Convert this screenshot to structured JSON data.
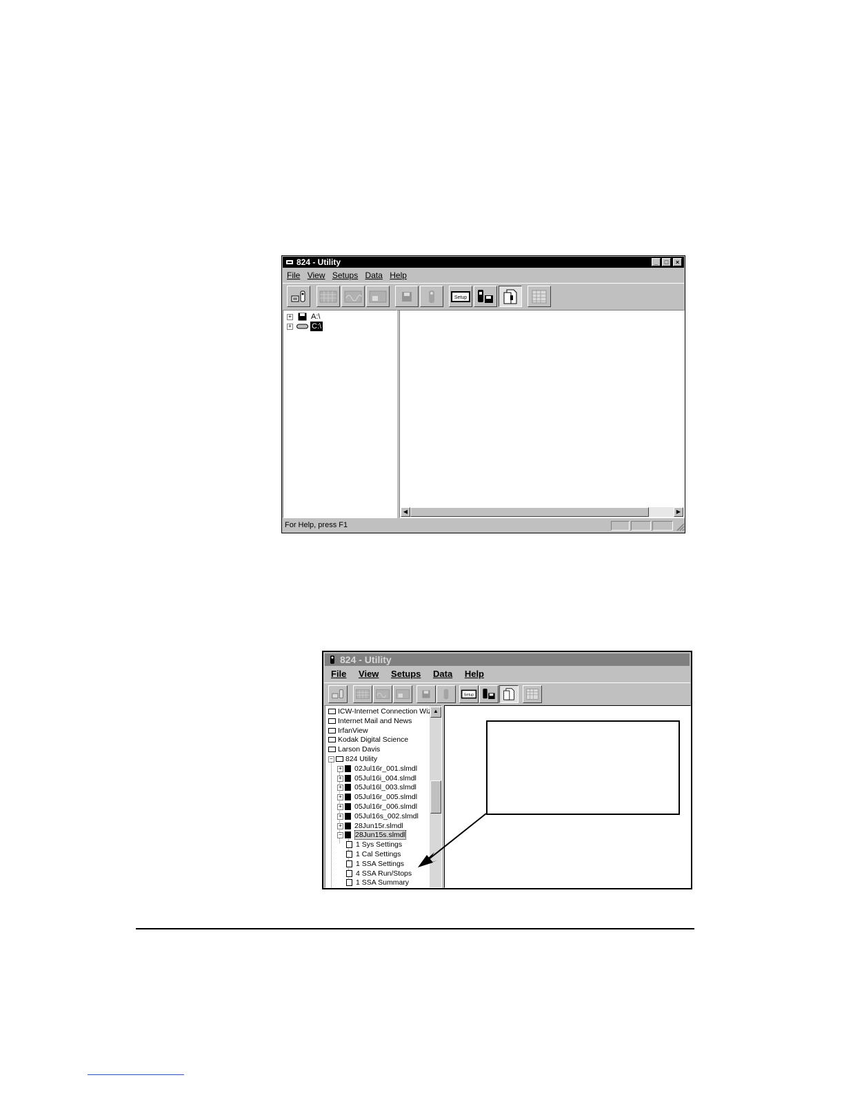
{
  "window1": {
    "title": "824 - Utility",
    "menu": [
      "File",
      "View",
      "Setups",
      "Data",
      "Help"
    ],
    "toolbar_buttons": [
      {
        "icon": "meter-to-pc-icon",
        "state": "normal"
      },
      {
        "icon": "grid-icon",
        "state": "normal"
      },
      {
        "icon": "grid-wave-icon",
        "state": "normal"
      },
      {
        "icon": "grid-disk-icon",
        "state": "normal"
      },
      {
        "icon": "disk-icon",
        "state": "normal"
      },
      {
        "icon": "meter-icon",
        "state": "normal"
      },
      {
        "icon": "setup-icon",
        "label": "Setup",
        "state": "normal"
      },
      {
        "icon": "meter-disk-icon",
        "state": "normal"
      },
      {
        "icon": "documents-icon",
        "state": "pressed"
      },
      {
        "icon": "spreadsheet-icon",
        "state": "normal"
      }
    ],
    "tree": [
      {
        "label": "A:\\",
        "icon": "floppy-drive-icon"
      },
      {
        "label": "C:\\",
        "icon": "hard-drive-icon",
        "selected": true
      }
    ],
    "status_text": "For Help, press F1"
  },
  "window2": {
    "title": "824 - Utility",
    "menu": [
      "File",
      "View",
      "Setups",
      "Data",
      "Help"
    ],
    "tree": [
      {
        "label": "ICW-Internet Connection Wiz",
        "type": "folder",
        "indent": 0
      },
      {
        "label": "Internet Mail and News",
        "type": "folder",
        "indent": 0
      },
      {
        "label": "IrfanView",
        "type": "folder",
        "indent": 0
      },
      {
        "label": "Kodak Digital Science",
        "type": "folder",
        "indent": 0
      },
      {
        "label": "Larson Davis",
        "type": "folder",
        "indent": 0
      },
      {
        "label": "824 Utility",
        "type": "folder-open",
        "indent": 1
      },
      {
        "label": "02Jul16r_001.slmdl",
        "type": "file",
        "indent": 2
      },
      {
        "label": "05Jul16i_004.slmdl",
        "type": "file",
        "indent": 2
      },
      {
        "label": "05Jul16l_003.slmdl",
        "type": "file",
        "indent": 2
      },
      {
        "label": "05Jul16r_005.slmdl",
        "type": "file",
        "indent": 2
      },
      {
        "label": "05Jul16r_006.slmdl",
        "type": "file",
        "indent": 2
      },
      {
        "label": "05Jul16s_002.slmdl",
        "type": "file",
        "indent": 2
      },
      {
        "label": "28Jun15r.slmdl",
        "type": "file",
        "indent": 2
      },
      {
        "label": "28Jun15s.slmdl",
        "type": "file",
        "indent": 2,
        "selected": true
      },
      {
        "label": "1 Sys Settings",
        "type": "record",
        "indent": 3
      },
      {
        "label": "1 Cal Settings",
        "type": "record",
        "indent": 3
      },
      {
        "label": "1 SSA Settings",
        "type": "record",
        "indent": 3
      },
      {
        "label": "4 SSA Run/Stops",
        "type": "record",
        "indent": 3
      },
      {
        "label": "1 SSA Summary",
        "type": "record",
        "indent": 3
      }
    ]
  }
}
